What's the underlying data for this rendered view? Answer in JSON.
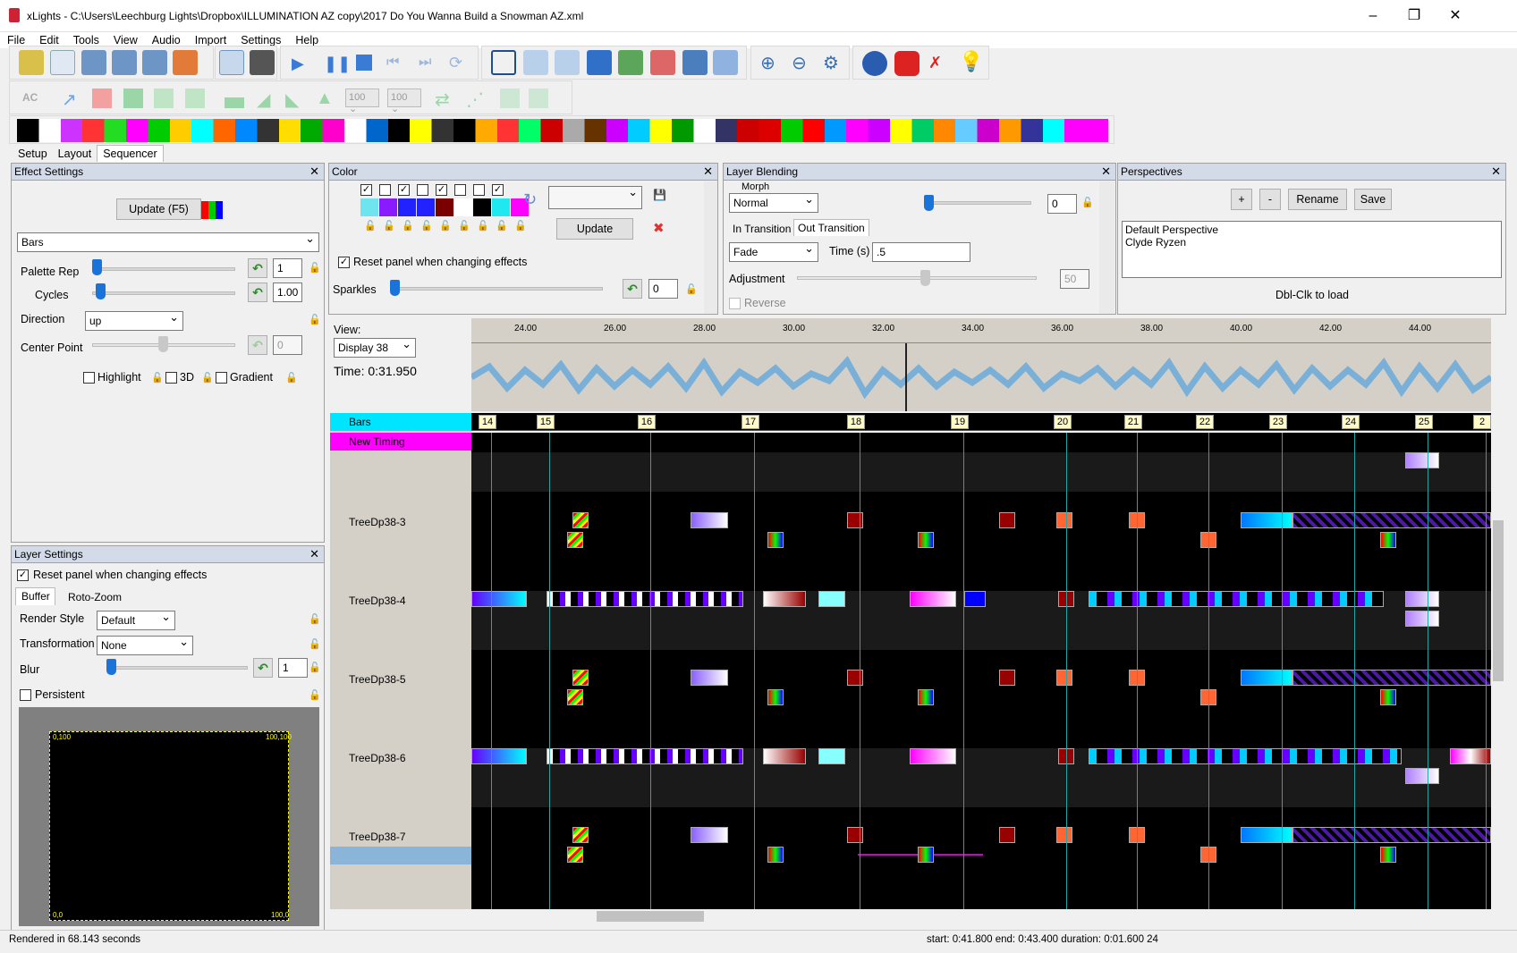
{
  "window": {
    "title": "xLights - C:\\Users\\Leechburg Lights\\Dropbox\\ILLUMINATION AZ copy\\2017 Do You Wanna Build a Snowman AZ.xml"
  },
  "menu": [
    "File",
    "Edit",
    "Tools",
    "View",
    "Audio",
    "Import",
    "Settings",
    "Help"
  ],
  "tabs": [
    "Setup",
    "Layout",
    "Sequencer"
  ],
  "effect_settings": {
    "title": "Effect Settings",
    "update_label": "Update (F5)",
    "effect": "Bars",
    "palette_rep_label": "Palette Rep",
    "palette_rep": "1",
    "cycles_label": "Cycles",
    "cycles": "1.00",
    "direction_label": "Direction",
    "direction": "up",
    "center_point_label": "Center Point",
    "center_point": "0",
    "highlight": "Highlight",
    "threed": "3D",
    "gradient": "Gradient"
  },
  "layer_settings": {
    "title": "Layer Settings",
    "reset": "Reset panel when changing effects",
    "tab_buffer": "Buffer",
    "tab_roto": "Roto-Zoom",
    "render_style_label": "Render Style",
    "render_style": "Default",
    "transformation_label": "Transformation",
    "transformation": "None",
    "blur_label": "Blur",
    "blur": "1",
    "persistent": "Persistent",
    "corner_tl": "0,100",
    "corner_tr": "100,100",
    "corner_bl": "0,0",
    "corner_br": "100,0"
  },
  "color": {
    "title": "Color",
    "swatches": [
      "#6ee5ee",
      "#8a1aff",
      "#2222ff",
      "#2222ff",
      "#7a0000",
      "#ffffff",
      "#000000",
      "#20e8f0",
      "#ff00ff"
    ],
    "checked": [
      true,
      false,
      true,
      false,
      true,
      false,
      false,
      true
    ],
    "update_label": "Update",
    "reset": "Reset panel when changing effects",
    "sparkles_label": "Sparkles",
    "sparkles": "0"
  },
  "layer_blending": {
    "title": "Layer Blending",
    "morph": "Morph",
    "mode": "Normal",
    "mode_value": "0",
    "in_transition": "In Transition",
    "out_transition": "Out Transition",
    "transition": "Fade",
    "time_label": "Time (s)",
    "time": ".5",
    "adjustment_label": "Adjustment",
    "adjustment": "50",
    "reverse": "Reverse"
  },
  "perspectives": {
    "title": "Perspectives",
    "add": "+",
    "remove": "-",
    "rename": "Rename",
    "save": "Save",
    "items": [
      "Default Perspective",
      "Clyde Ryzen"
    ],
    "hint": "Dbl-Clk to load"
  },
  "timeline": {
    "view_label": "View:",
    "view": "Display 38",
    "time": "Time: 0:31.950",
    "ticks": [
      "24.00",
      "26.00",
      "28.00",
      "30.00",
      "32.00",
      "34.00",
      "36.00",
      "38.00",
      "40.00",
      "42.00",
      "44.00"
    ],
    "markers": [
      "14",
      "15",
      "16",
      "17",
      "18",
      "19",
      "20",
      "21",
      "22",
      "23",
      "24",
      "25",
      "2"
    ]
  },
  "rows": {
    "timing_bars": "Bars",
    "timing_new": "New Timing",
    "models": [
      "TreeDp38-3",
      "TreeDp38-4",
      "TreeDp38-5",
      "TreeDp38-6",
      "TreeDp38-7"
    ]
  },
  "status": {
    "left": "Rendered in  68.143 seconds",
    "right": "start: 0:41.800 end: 0:43.400 duration: 0:01.600 24"
  }
}
